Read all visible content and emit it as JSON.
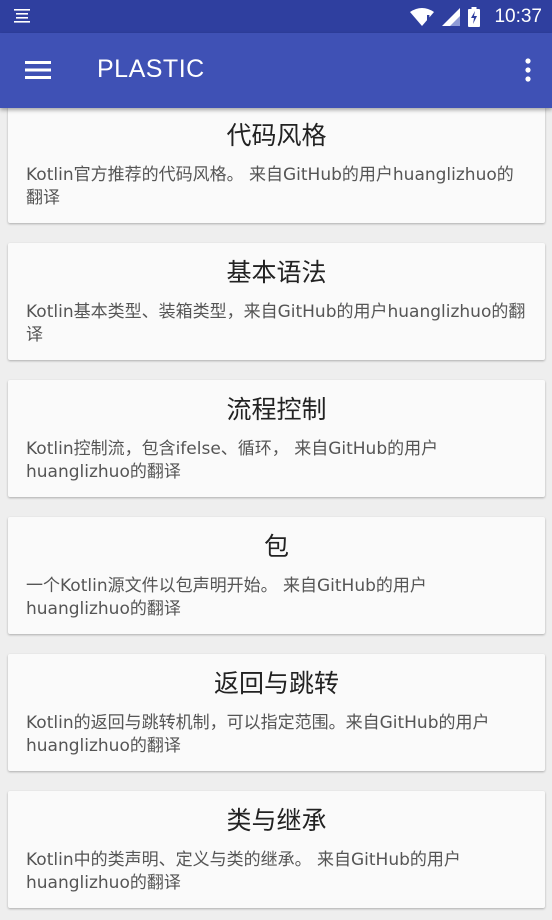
{
  "status_bar": {
    "time": "10:37",
    "icons": [
      "notification-list-icon",
      "wifi-icon",
      "signal-icon",
      "battery-charging-icon"
    ]
  },
  "app_bar": {
    "title": "PLASTIC",
    "menu_icon": "hamburger-menu-icon",
    "overflow_icon": "more-vert-icon"
  },
  "colors": {
    "primary": "#3f51b5",
    "primary_dark": "#2f3f9f",
    "background": "#eeeeee",
    "card": "#fafafa"
  },
  "cards": [
    {
      "title": "代码风格",
      "description": "Kotlin官方推荐的代码风格。 来自GitHub的用户huanglizhuo的翻译"
    },
    {
      "title": "基本语法",
      "description": "Kotlin基本类型、装箱类型，来自GitHub的用户huanglizhuo的翻译"
    },
    {
      "title": "流程控制",
      "description": "Kotlin控制流，包含ifelse、循环， 来自GitHub的用户huanglizhuo的翻译"
    },
    {
      "title": "包",
      "description": "一个Kotlin源文件以包声明开始。 来自GitHub的用户huanglizhuo的翻译"
    },
    {
      "title": "返回与跳转",
      "description": "Kotlin的返回与跳转机制，可以指定范围。来自GitHub的用户huanglizhuo的翻译"
    },
    {
      "title": "类与继承",
      "description": "Kotlin中的类声明、定义与类的继承。 来自GitHub的用户huanglizhuo的翻译"
    }
  ]
}
